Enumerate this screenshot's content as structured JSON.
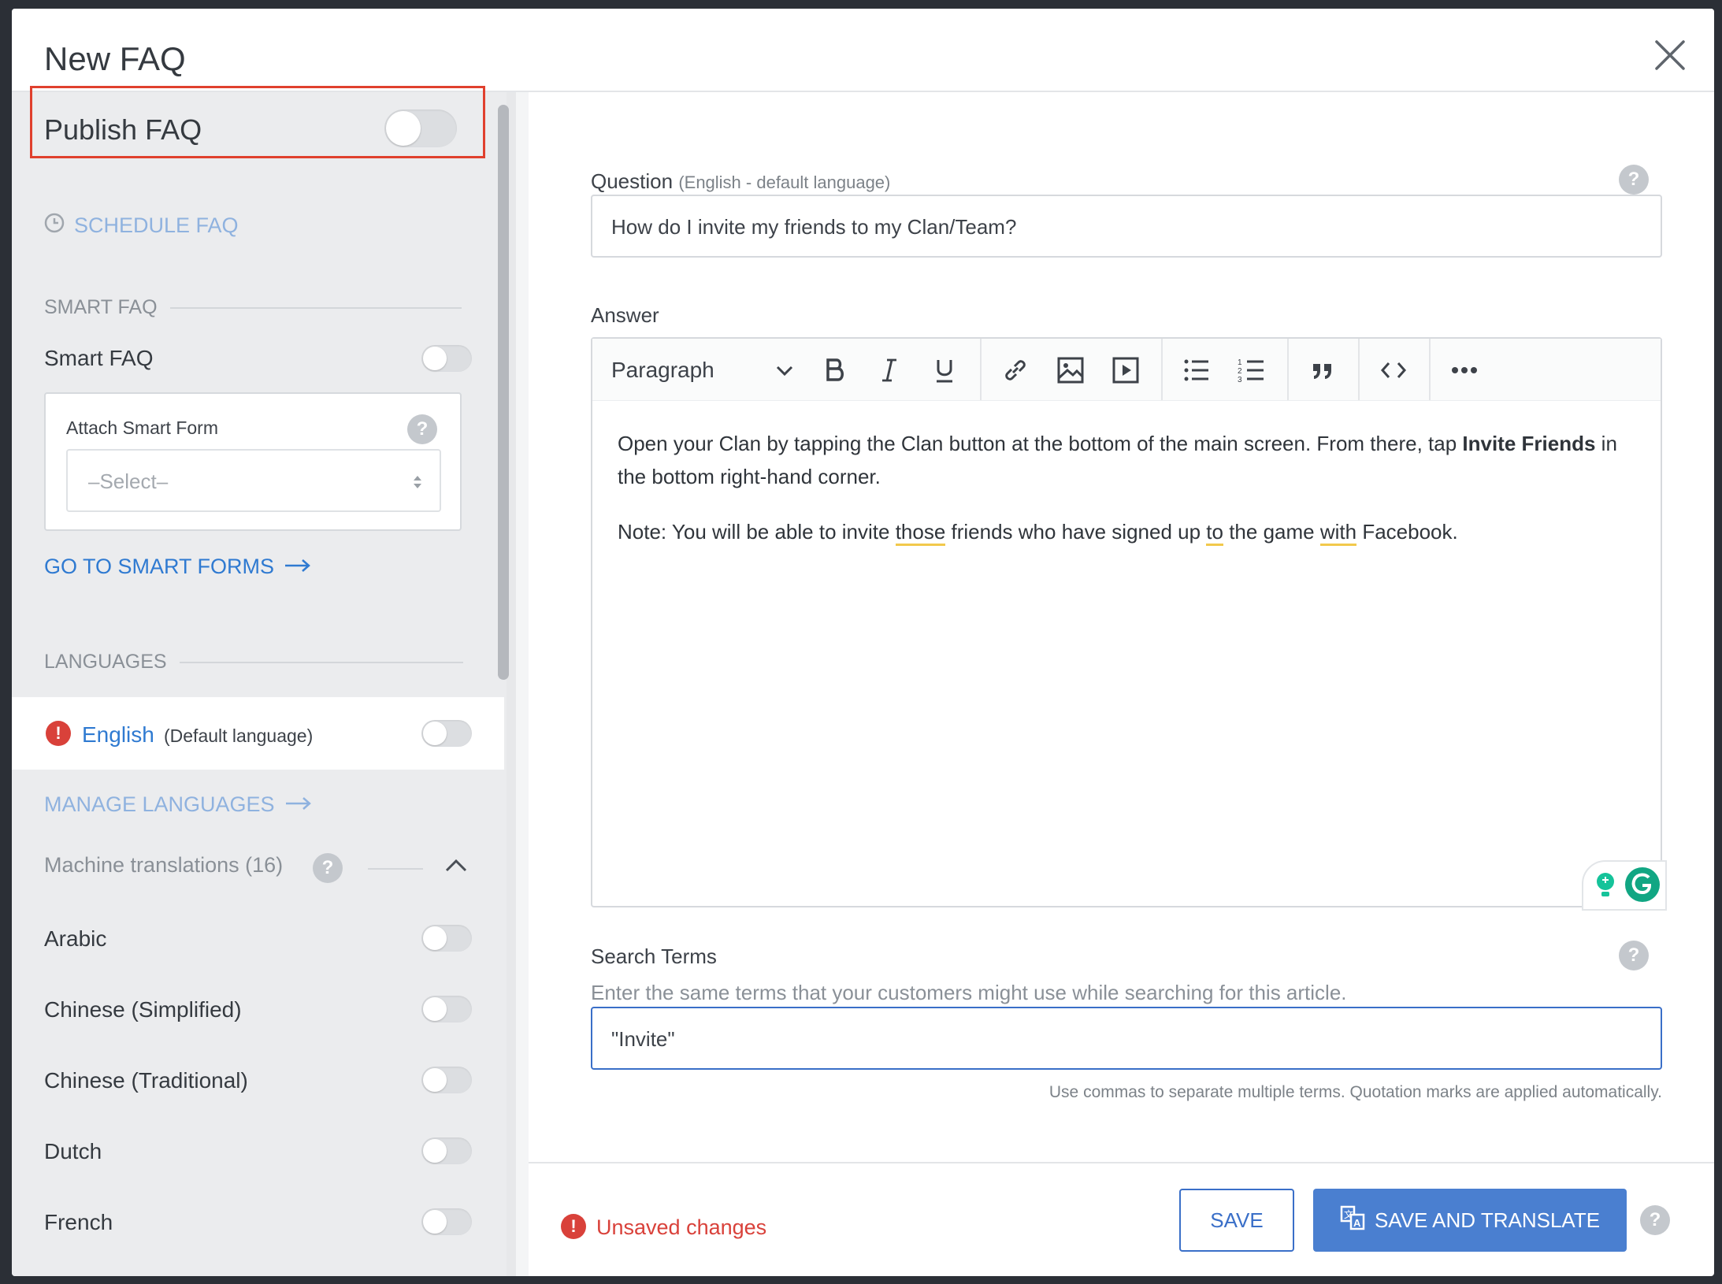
{
  "modal": {
    "title": "New FAQ"
  },
  "sidebar": {
    "publish_label": "Publish FAQ",
    "schedule_label": "SCHEDULE FAQ",
    "smart_section": "SMART FAQ",
    "smart_label": "Smart FAQ",
    "attach_label": "Attach Smart Form",
    "select_placeholder": "–Select–",
    "go_smart_forms": "GO TO SMART FORMS",
    "languages_section": "LANGUAGES",
    "default_lang": {
      "name": "English",
      "note": "(Default language)"
    },
    "manage_languages": "MANAGE LANGUAGES",
    "machine_translations": "Machine translations (16)",
    "languages": [
      {
        "name": "Arabic"
      },
      {
        "name": "Chinese (Simplified)"
      },
      {
        "name": "Chinese (Traditional)"
      },
      {
        "name": "Dutch"
      },
      {
        "name": "French"
      }
    ]
  },
  "main": {
    "question_label": "Question",
    "question_sub": "(English - default language)",
    "question_value": "How do I invite my friends to my Clan/Team?",
    "answer_label": "Answer",
    "toolbar": {
      "block_style": "Paragraph"
    },
    "answer": {
      "p1_before": "Open your Clan by tapping the Clan button at the bottom of the main screen. From there, tap ",
      "p1_bold": "Invite Friends",
      "p1_after": " in the bottom right-hand corner.",
      "p2_a": "Note: You will be able to invite ",
      "p2_w1": "those",
      "p2_b": " friends who have signed up ",
      "p2_w2": "to",
      "p2_c": " the game ",
      "p2_w3": "with",
      "p2_d": " Facebook."
    },
    "search_label": "Search Terms",
    "search_help": "Enter the same terms that your customers might use while searching for this article.",
    "search_value": "\"Invite\"",
    "search_hint": "Use commas to separate multiple terms. Quotation marks are applied automatically."
  },
  "footer": {
    "unsaved": "Unsaved changes",
    "save": "SAVE",
    "save_translate": "SAVE AND TRANSLATE"
  },
  "colors": {
    "accent": "#3a6fc8",
    "error": "#d9413a",
    "highlight": "#e0402e"
  }
}
